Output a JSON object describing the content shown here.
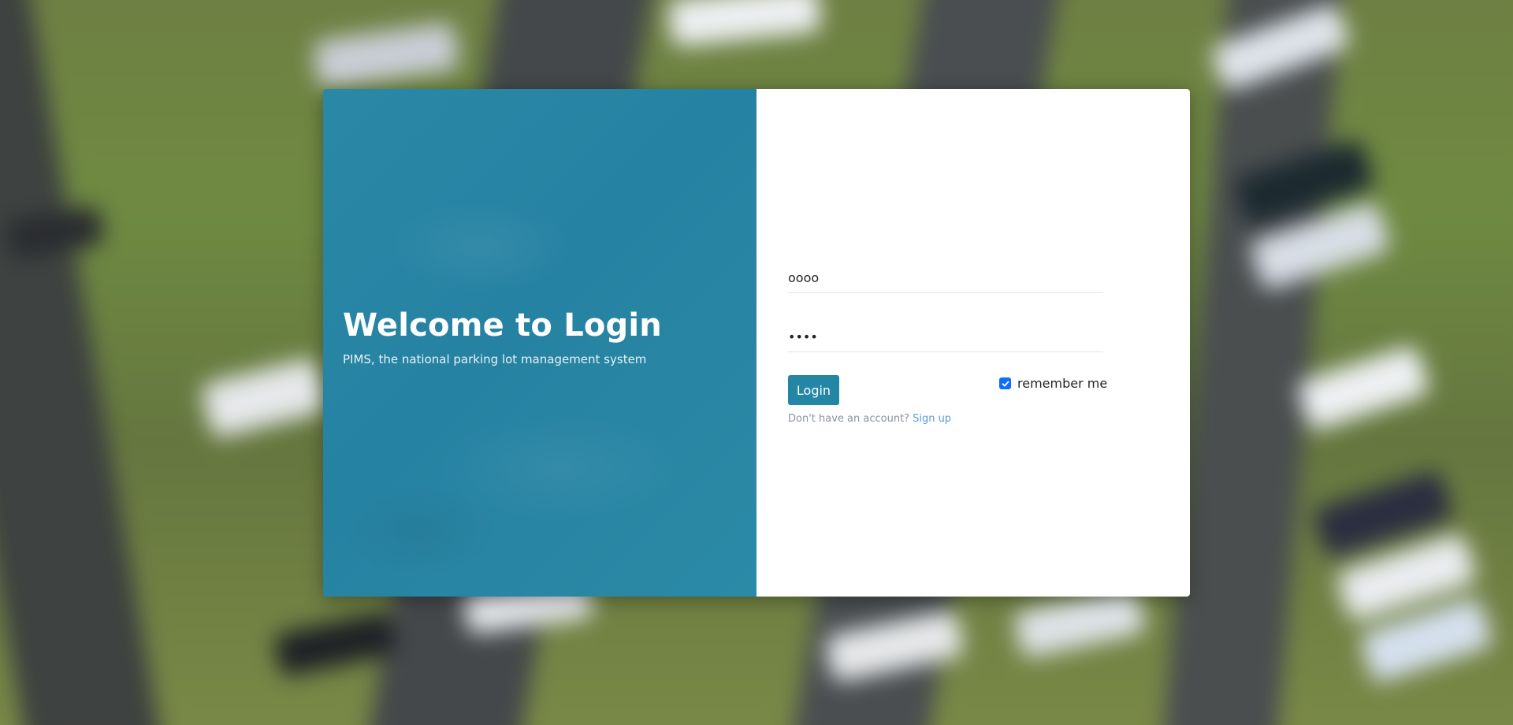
{
  "background": {
    "description_icon": "parking-lot-aerial-image"
  },
  "left": {
    "title": "Welcome to Login",
    "subtitle": "PIMS, the national parking lot management system"
  },
  "form": {
    "username_value": "oooo",
    "password_value": "oooo",
    "login_label": "Login",
    "remember_label": "remember me",
    "remember_checked": true,
    "no_account_text": "Don't have an account?",
    "signup_label": "Sign up"
  },
  "colors": {
    "panel": "#2686a4",
    "button": "#2386a5",
    "checkbox": "#0d6efd",
    "link": "#5b9bd5"
  }
}
